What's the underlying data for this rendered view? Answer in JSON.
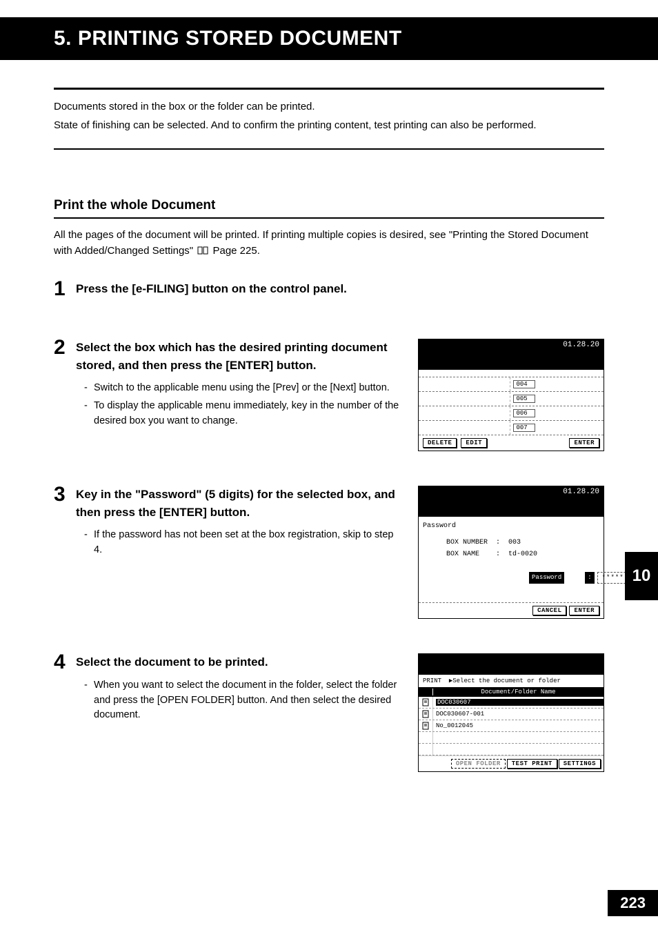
{
  "title": "5. PRINTING STORED DOCUMENT",
  "intro": {
    "line1": "Documents stored in the box or the folder can be printed.",
    "line2": "State of finishing can be selected. And to confirm the printing content, test printing can also be performed."
  },
  "section": {
    "heading": "Print the whole Document",
    "desc1": "All the pages of the document will be printed. If printing multiple copies is desired, see \"Printing the Stored Document with Added/Changed Settings\" ",
    "desc2_pageref": "Page 225."
  },
  "steps": {
    "s1": {
      "num": "1",
      "heading": "Press the [e-FILING] button on the control panel."
    },
    "s2": {
      "num": "2",
      "heading": "Select the box which has the desired printing document stored, and then press the [ENTER] button.",
      "bullets": [
        "Switch to the applicable menu using the [Prev] or the [Next] button.",
        "To display the applicable menu immediately, key in the number of the desired box you want to change."
      ],
      "panel": {
        "time": "01.28.20",
        "boxes": [
          "004",
          "005",
          "006",
          "007"
        ],
        "btn_delete": "DELETE",
        "btn_edit": "EDIT",
        "btn_enter": "ENTER"
      }
    },
    "s3": {
      "num": "3",
      "heading": "Key in the \"Password\" (5 digits) for the selected box, and then press the [ENTER] button.",
      "bullets": [
        "If the password has not been set at the box registration, skip to step 4."
      ],
      "panel": {
        "time": "01.28.20",
        "label": "Password",
        "boxnum_label": "BOX NUMBER",
        "boxnum": "003",
        "boxname_label": "BOX NAME",
        "boxname": "td-0020",
        "pw_label": "Password",
        "pw_value": "*****",
        "btn_cancel": "CANCEL",
        "btn_enter": "ENTER"
      }
    },
    "s4": {
      "num": "4",
      "heading": "Select the document to be printed.",
      "bullets": [
        "When you want to select the document in the folder, select the folder and press the [OPEN FOLDER] button. And then select the desired document."
      ],
      "panel": {
        "crumb_print": "PRINT",
        "crumb_text": "Select the document or folder",
        "colhead": "Document/Folder Name",
        "rows": [
          "DOC030607",
          "DOC030607-001",
          "No_0012045"
        ],
        "btn_open": "OPEN FOLDER",
        "btn_test": "TEST PRINT",
        "btn_settings": "SETTINGS"
      }
    }
  },
  "side_tab": "10",
  "page_number": "223"
}
